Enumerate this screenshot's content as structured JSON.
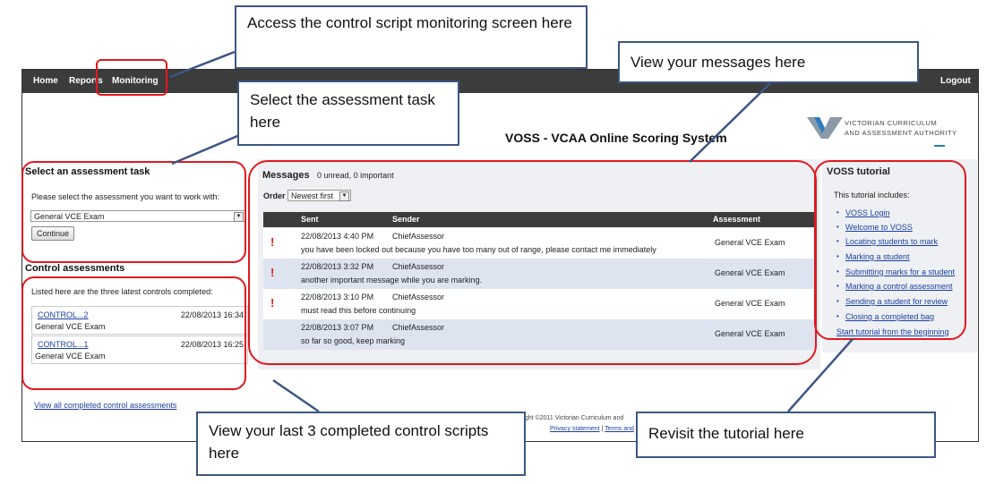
{
  "nav": {
    "home": "Home",
    "reports": "Reports",
    "monitoring": "Monitoring",
    "logout": "Logout"
  },
  "header": {
    "title": "VOSS - VCAA Online Scoring System"
  },
  "logo": {
    "line1": "VICTORIAN CURRICULUM",
    "line2": "AND ASSESSMENT AUTHORITY"
  },
  "select_task": {
    "title": "Select an assessment task",
    "prompt": "Please select the assessment you want to work with:",
    "selected": "General VCE Exam",
    "button": "Continue"
  },
  "controls": {
    "title": "Control assessments",
    "intro": "Listed here are the three latest controls completed:",
    "items": [
      {
        "link": "CONTROL...2",
        "time": "22/08/2013 16:34",
        "exam": "General VCE Exam"
      },
      {
        "link": "CONTROL...1",
        "time": "22/08/2013 16:25",
        "exam": "General VCE Exam"
      }
    ],
    "view_all": "View all completed control assessments"
  },
  "messages": {
    "title": "Messages",
    "summary": "0 unread, 0 important",
    "order_label": "Order",
    "order_value": "Newest first",
    "headers": {
      "sent": "Sent",
      "sender": "Sender",
      "assessment": "Assessment"
    },
    "rows": [
      {
        "important": true,
        "sent": "22/08/2013 4:40 PM",
        "sender": "ChiefAssessor",
        "body": "you have been locked out because you have too many out of range, please contact me immediately",
        "assessment": "General VCE Exam"
      },
      {
        "important": true,
        "sent": "22/08/2013 3:32 PM",
        "sender": "ChiefAssessor",
        "body": "another important message while you are marking.",
        "assessment": "General VCE Exam"
      },
      {
        "important": true,
        "sent": "22/08/2013 3:10 PM",
        "sender": "ChiefAssessor",
        "body": "must read this before continuing",
        "assessment": "General VCE Exam"
      },
      {
        "important": false,
        "sent": "22/08/2013 3:07 PM",
        "sender": "ChiefAssessor",
        "body": "so far so good, keep marking",
        "assessment": "General VCE Exam"
      }
    ],
    "important_icon": "!"
  },
  "tutorial": {
    "title": "VOSS tutorial",
    "intro": "This tutorial includes:",
    "items": [
      "VOSS Login",
      "Welcome to VOSS",
      "Locating students to mark",
      "Marking a student",
      "Submitting marks for a student",
      "Marking a control assessment",
      "Sending a student for review",
      "Closing a completed bag"
    ],
    "restart": "Start tutorial from the beginning"
  },
  "footer": {
    "copyright": "right ©2011 Victorian Curriculum and",
    "privacy": "Privacy statement",
    "sep": " | ",
    "terms": "Terms and"
  },
  "callouts": {
    "monitoring": "Access the control script monitoring screen here",
    "messages": "View your messages here",
    "task": "Select the assessment task here",
    "controls": "View your last 3 completed control scripts here",
    "tutorial": "Revisit the tutorial here"
  },
  "colors": {
    "highlight": "#e2181f",
    "callout_border": "#3d5683",
    "nav_bg": "#3c3c3c",
    "link": "#1a3fa0",
    "important": "#d8211a"
  }
}
